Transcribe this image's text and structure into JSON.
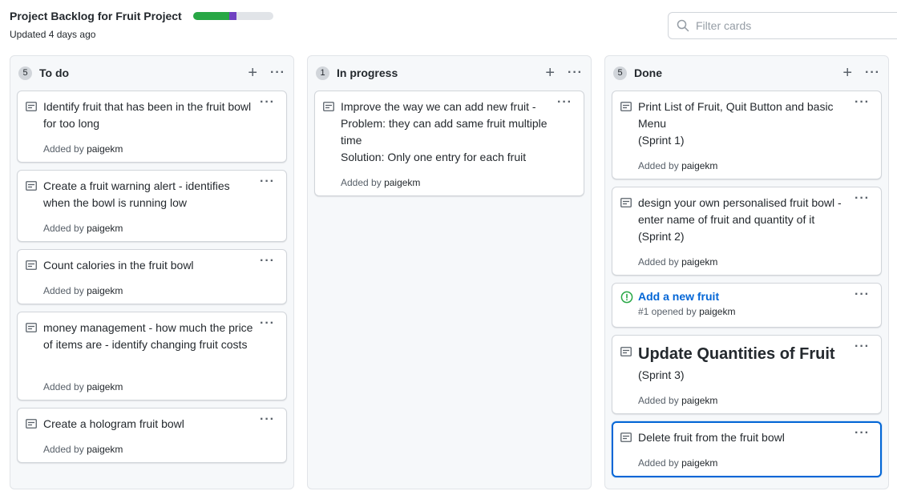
{
  "header": {
    "title": "Project Backlog for Fruit Project",
    "updated": "Updated 4 days ago",
    "progress": {
      "done_fraction": 0.45,
      "in_progress_fraction": 0.09,
      "done_color": "#28a745",
      "in_progress_color": "#6f42c1"
    }
  },
  "filter": {
    "placeholder": "Filter cards",
    "icon": "search-icon"
  },
  "columns": [
    {
      "name": "To do",
      "count": "5",
      "cards": [
        {
          "text": "Identify fruit that has been in the fruit bowl for too long",
          "added_prefix": "Added by",
          "user": "paigekm"
        },
        {
          "text": "Create a fruit warning alert - identifies when the bowl is running low",
          "added_prefix": "Added by",
          "user": "paigekm"
        },
        {
          "text": "Count calories in the fruit bowl",
          "added_prefix": "Added by",
          "user": "paigekm"
        },
        {
          "text": "money management - how much the price of items are - identify changing fruit costs",
          "added_prefix": "Added by",
          "user": "paigekm"
        },
        {
          "text": "Create a hologram fruit bowl",
          "added_prefix": "Added by",
          "user": "paigekm"
        }
      ]
    },
    {
      "name": "In progress",
      "count": "1",
      "cards": [
        {
          "text": "Improve the way we can add new fruit - Problem: they can add same fruit multiple time",
          "text2": "Solution: Only one entry for each fruit",
          "added_prefix": "Added by",
          "user": "paigekm"
        }
      ]
    },
    {
      "name": "Done",
      "count": "5",
      "cards": [
        {
          "text": "Print List of Fruit, Quit Button and basic Menu",
          "text2": "(Sprint 1)",
          "added_prefix": "Added by",
          "user": "paigekm"
        },
        {
          "text": "design your own personalised fruit bowl - enter name of fruit and quantity of it",
          "text2": "(Sprint 2)",
          "added_prefix": "Added by",
          "user": "paigekm"
        },
        {
          "issue_title": "Add a new fruit",
          "issue_meta_prefix": "#1 opened by",
          "user": "paigekm"
        },
        {
          "text": "Update Quantities of Fruit",
          "text2": "(Sprint 3)",
          "added_prefix": "Added by",
          "user": "paigekm"
        },
        {
          "text": "Delete fruit from the fruit bowl",
          "added_prefix": "Added by",
          "user": "paigekm"
        }
      ]
    }
  ],
  "icons": {
    "add": "+",
    "more": "···",
    "note": "note-icon",
    "issue_open": "issue-opened-icon",
    "issue_color": "#28a745"
  }
}
